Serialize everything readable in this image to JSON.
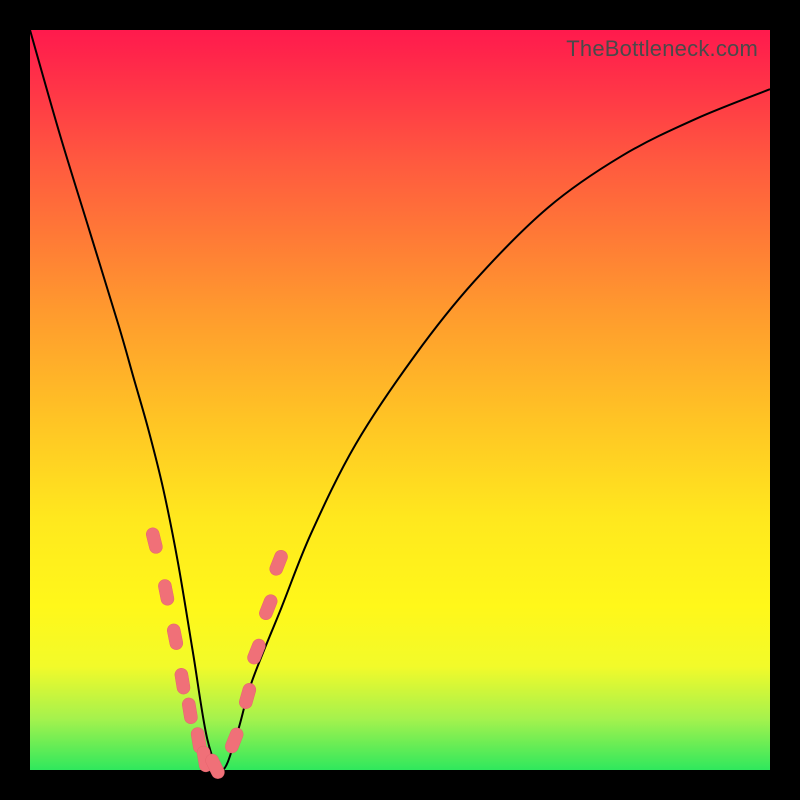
{
  "watermark": "TheBottleneck.com",
  "colors": {
    "frame_bg_top": "#ff1a4d",
    "frame_bg_bottom": "#2fe85d",
    "page_bg": "#000000",
    "curve": "#000000",
    "marker": "#f07078"
  },
  "chart_data": {
    "type": "line",
    "title": "",
    "xlabel": "",
    "ylabel": "",
    "xlim": [
      0,
      100
    ],
    "ylim": [
      0,
      100
    ],
    "note": "Values estimated from pixels; y is bottleneck percentage (0 at bottom).",
    "series": [
      {
        "name": "bottleneck-curve",
        "x": [
          0,
          4,
          8,
          12,
          14,
          16,
          18,
          20,
          22,
          24,
          26,
          28,
          30,
          34,
          38,
          44,
          52,
          60,
          70,
          80,
          90,
          100
        ],
        "y": [
          100,
          86,
          73,
          60,
          53,
          46,
          38,
          28,
          16,
          4,
          0,
          5,
          12,
          22,
          32,
          44,
          56,
          66,
          76,
          83,
          88,
          92
        ]
      }
    ],
    "markers": {
      "name": "highlighted-points",
      "x": [
        16.8,
        18.4,
        19.6,
        20.6,
        21.6,
        22.8,
        23.6,
        25.0,
        27.6,
        29.4,
        30.6,
        32.2,
        33.6
      ],
      "y": [
        31.0,
        24.0,
        18.0,
        12.0,
        8.0,
        4.0,
        1.5,
        0.5,
        4.0,
        10.0,
        16.0,
        22.0,
        28.0
      ]
    }
  }
}
